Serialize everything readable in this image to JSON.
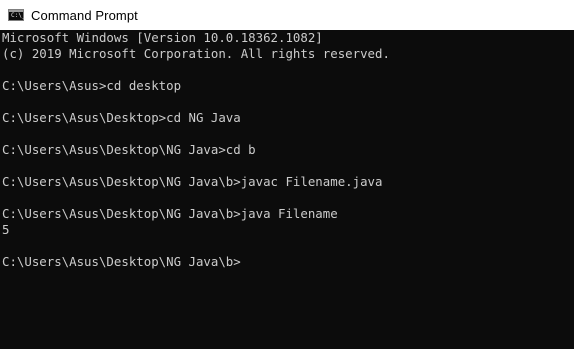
{
  "window": {
    "title": "Command Prompt",
    "icon": "cmd-icon",
    "icon_text": "C:\\_"
  },
  "colors": {
    "console_bg": "#0c0c0c",
    "console_fg": "#cccccc",
    "titlebar_bg": "#ffffff"
  },
  "console": {
    "lines": [
      "Microsoft Windows [Version 10.0.18362.1082]",
      "(c) 2019 Microsoft Corporation. All rights reserved.",
      "",
      "C:\\Users\\Asus>cd desktop",
      "",
      "C:\\Users\\Asus\\Desktop>cd NG Java",
      "",
      "C:\\Users\\Asus\\Desktop\\NG Java>cd b",
      "",
      "C:\\Users\\Asus\\Desktop\\NG Java\\b>javac Filename.java",
      "",
      "C:\\Users\\Asus\\Desktop\\NG Java\\b>java Filename",
      "5",
      "",
      "C:\\Users\\Asus\\Desktop\\NG Java\\b>"
    ]
  }
}
